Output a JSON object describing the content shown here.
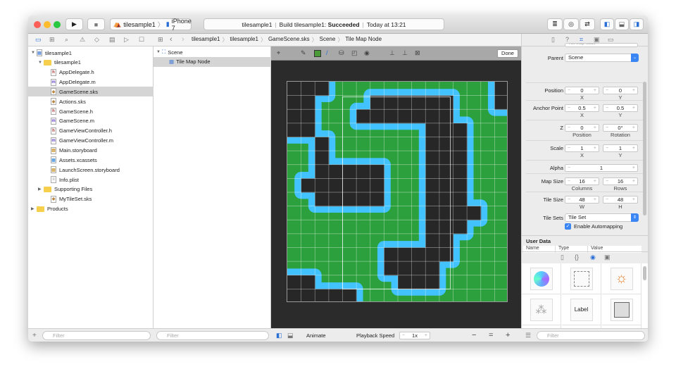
{
  "toolbar": {
    "scheme": "tilesample1",
    "device": "iPhone 7",
    "status_project": "tilesample1",
    "status_build": "Build tilesample1: ",
    "status_result": "Succeeded",
    "status_time": "Today at 13:21"
  },
  "jumpbar": [
    "tilesample1",
    "tilesample1",
    "GameScene.sks",
    "Scene",
    "Tile Map Node"
  ],
  "navigator": {
    "items": [
      {
        "label": "tilesample1",
        "indent": 0,
        "kind": "project",
        "disclosure": "open"
      },
      {
        "label": "tilesample1",
        "indent": 1,
        "kind": "folder",
        "disclosure": "open"
      },
      {
        "label": "AppDelegate.h",
        "indent": 2,
        "kind": "h"
      },
      {
        "label": "AppDelegate.m",
        "indent": 2,
        "kind": "m"
      },
      {
        "label": "GameScene.sks",
        "indent": 2,
        "kind": "sks",
        "selected": true
      },
      {
        "label": "Actions.sks",
        "indent": 2,
        "kind": "sks"
      },
      {
        "label": "GameScene.h",
        "indent": 2,
        "kind": "h"
      },
      {
        "label": "GameScene.m",
        "indent": 2,
        "kind": "m"
      },
      {
        "label": "GameViewController.h",
        "indent": 2,
        "kind": "h"
      },
      {
        "label": "GameViewController.m",
        "indent": 2,
        "kind": "m"
      },
      {
        "label": "Main.storyboard",
        "indent": 2,
        "kind": "storyboard"
      },
      {
        "label": "Assets.xcassets",
        "indent": 2,
        "kind": "assets"
      },
      {
        "label": "LaunchScreen.storyboard",
        "indent": 2,
        "kind": "storyboard"
      },
      {
        "label": "Info.plist",
        "indent": 2,
        "kind": "plist"
      },
      {
        "label": "Supporting Files",
        "indent": 1,
        "kind": "folder",
        "disclosure": "closed"
      },
      {
        "label": "MyTileSet.sks",
        "indent": 2,
        "kind": "sks"
      },
      {
        "label": "Products",
        "indent": 0,
        "kind": "folder",
        "disclosure": "closed"
      }
    ],
    "filter_placeholder": "Filter"
  },
  "outline": {
    "items": [
      {
        "label": "Scene",
        "indent": 0
      },
      {
        "label": "Tile Map Node",
        "indent": 1,
        "selected": true
      }
    ],
    "filter_placeholder": "Filter"
  },
  "tile_editor": {
    "done_label": "Done",
    "paint_color": "#4a9a3a",
    "tile_map_rows": [
      "###............#",
      "##....######...#",
      "##...#######....",
      "##........###...",
      "..#.......###...",
      "..#.......###...",
      "..#####...###...",
      ".######...###...",
      "..#####...###...",
      "..........####..",
      "..........###...",
      "..........##....",
      ".......#####....",
      ".......####.....",
      "##......###.....",
      "#####..........."
    ],
    "colors": {
      "grass": "#2ca03d",
      "water": "#42c3ff",
      "void": "#272727"
    }
  },
  "editor_bottom": {
    "animate_label": "Animate",
    "speed_label": "Playback Speed",
    "speed_value": "1x"
  },
  "inspector": {
    "name_partial": "Tile Map Node",
    "parent_label": "Parent",
    "parent_value": "Scene",
    "fields": [
      {
        "label": "Position",
        "a": "0",
        "b": "0",
        "sa": "X",
        "sb": "Y"
      },
      {
        "label": "Anchor Point",
        "a": "0.5",
        "b": "0.5",
        "sa": "X",
        "sb": "Y"
      },
      {
        "label": "Z",
        "a": "0",
        "b": "0°",
        "sa": "Position",
        "sb": "Rotation"
      },
      {
        "label": "Scale",
        "a": "1",
        "b": "1",
        "sa": "X",
        "sb": "Y"
      },
      {
        "label": "Alpha",
        "a": "1"
      },
      {
        "label": "Map Size",
        "a": "16",
        "b": "16",
        "sa": "Columns",
        "sb": "Rows"
      },
      {
        "label": "Tile Size",
        "a": "48",
        "b": "48",
        "sa": "W",
        "sb": "H"
      }
    ],
    "tilesets_label": "Tile Sets",
    "tilesets_value": "Tile Set",
    "automapping_label": "Enable Automapping",
    "automapping_checked": true,
    "userdata_header": "User Data",
    "userdata_columns": [
      "Name",
      "Type",
      "Value"
    ]
  },
  "library": {
    "items": [
      "color-sprite",
      "empty-node",
      "light",
      "emitter",
      "Label",
      "shape",
      "tile-map",
      "camera",
      "reference"
    ],
    "label_text": "Label",
    "filter_placeholder": "Filter"
  }
}
